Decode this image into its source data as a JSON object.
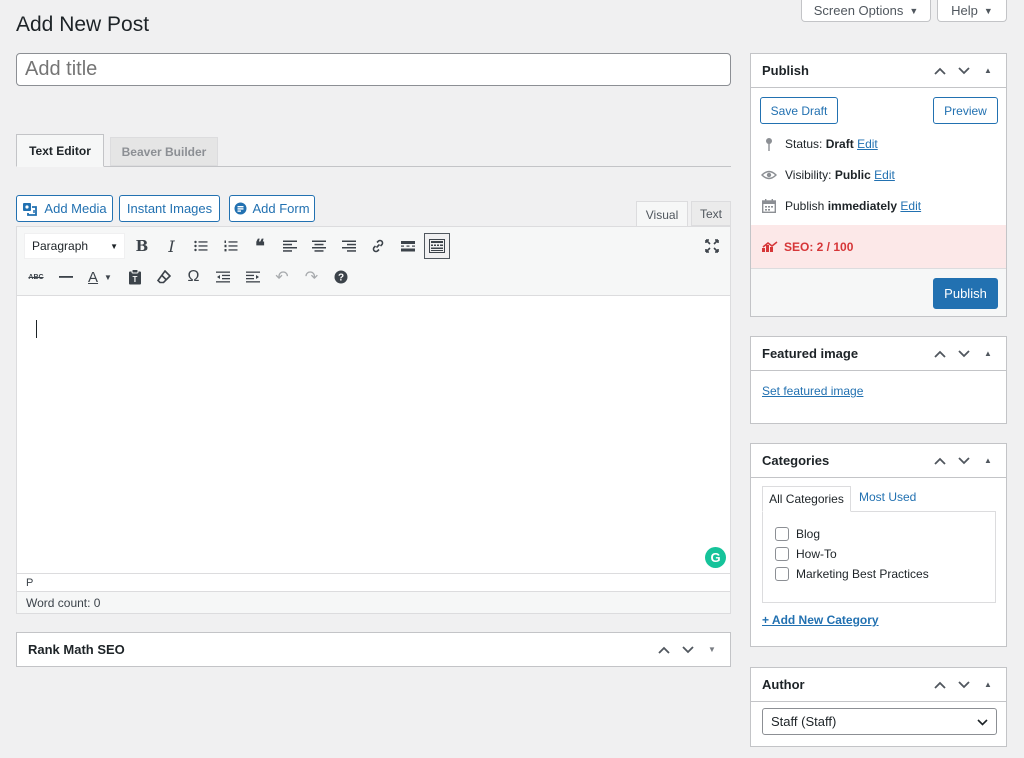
{
  "page": {
    "title": "Add New Post"
  },
  "screen_tabs": {
    "screen_options": "Screen Options",
    "help": "Help"
  },
  "title_input": {
    "placeholder": "Add title"
  },
  "editor_tabs": {
    "text_editor": "Text Editor",
    "beaver_builder": "Beaver Builder"
  },
  "media_buttons": {
    "add_media": "Add Media",
    "instant_images": "Instant Images",
    "add_form": "Add Form"
  },
  "mode_tabs": {
    "visual": "Visual",
    "text": "Text"
  },
  "toolbar": {
    "format_select": "Paragraph"
  },
  "status_bar": {
    "path": "P",
    "word_count": "Word count: 0"
  },
  "rank_math": {
    "title": "Rank Math SEO"
  },
  "publish": {
    "title": "Publish",
    "save_draft": "Save Draft",
    "preview": "Preview",
    "status_label": "Status:",
    "status_value": "Draft",
    "visibility_label": "Visibility:",
    "visibility_value": "Public",
    "publish_label": "Publish",
    "publish_value": "immediately",
    "edit": "Edit",
    "seo": "SEO: 2 / 100",
    "publish_button": "Publish"
  },
  "featured_image": {
    "title": "Featured image",
    "link": "Set featured image"
  },
  "categories": {
    "title": "Categories",
    "tab_all": "All Categories",
    "tab_most_used": "Most Used",
    "items": [
      "Blog",
      "How-To",
      "Marketing Best Practices"
    ],
    "add_new": "+ Add New Category"
  },
  "author": {
    "title": "Author",
    "selected": "Staff (Staff)"
  },
  "colors": {
    "accent": "#2271b1",
    "seo_bg": "#fce8e8",
    "seo_text": "#d63638",
    "grammarly": "#15c39a"
  }
}
